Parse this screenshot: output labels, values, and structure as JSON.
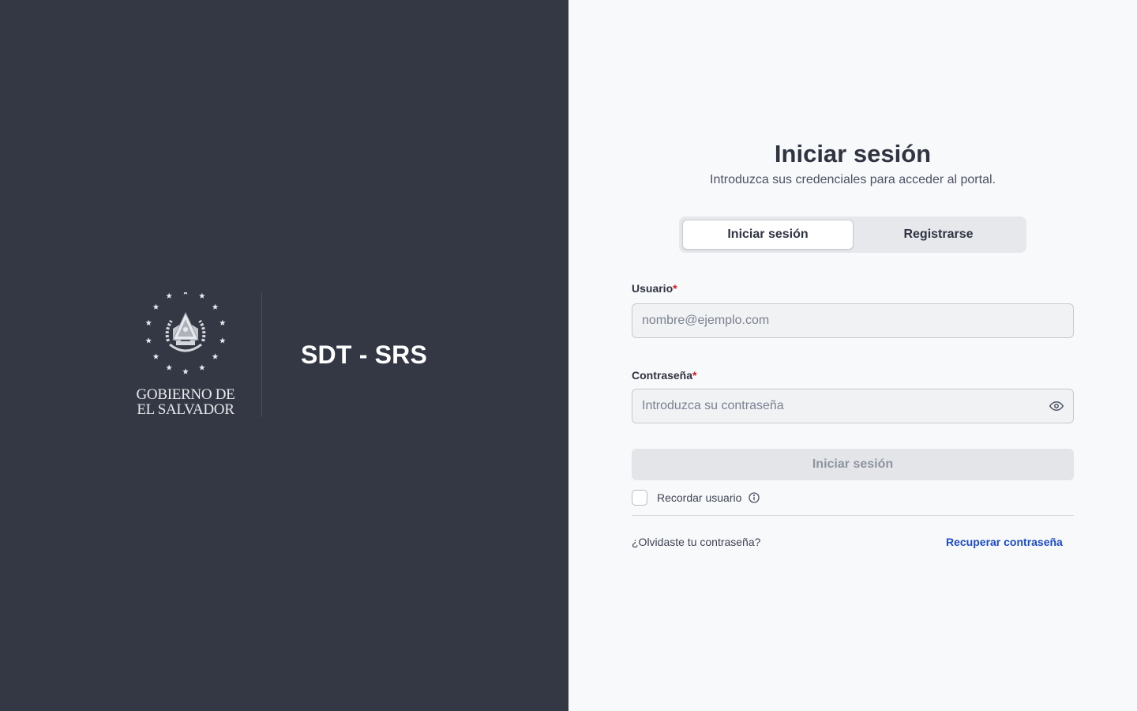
{
  "brand": {
    "emblem_icon": "el-salvador-coat-of-arms-icon",
    "gov_text": "GOBIERNO DE\nEL SALVADOR",
    "app_name": "SDT - SRS"
  },
  "login": {
    "title": "Iniciar sesión",
    "subtitle": "Introduzca sus credenciales para acceder al portal.",
    "tabs": [
      {
        "label": "Iniciar sesión",
        "active": true
      },
      {
        "label": "Registrarse",
        "active": false
      }
    ],
    "username": {
      "label": "Usuario",
      "required_mark": "*",
      "value": "",
      "placeholder": "nombre@ejemplo.com"
    },
    "password": {
      "label": "Contraseña",
      "required_mark": "*",
      "value": "",
      "placeholder": "Introduzca su contraseña",
      "toggle_icon": "eye-icon"
    },
    "submit_label": "Iniciar sesión",
    "remember": {
      "label": "Recordar usuario",
      "checked": false,
      "info_icon": "info-circle-icon"
    },
    "forgot_text": "¿Olvidaste tu contraseña?",
    "recover_link": "Recuperar contraseña"
  },
  "colors": {
    "left_bg": "#333844",
    "right_bg": "#f8f9fb",
    "link": "#1c4bc4",
    "required": "#d0161f"
  }
}
